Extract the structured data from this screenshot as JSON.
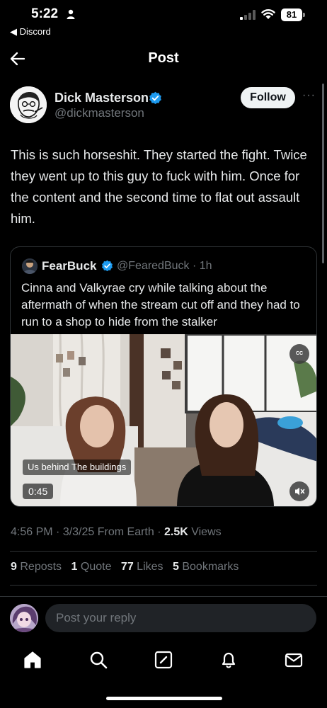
{
  "status_bar": {
    "time": "5:22",
    "back_app": "◀ Discord",
    "battery": "81"
  },
  "header": {
    "title": "Post"
  },
  "post": {
    "author_name": "Dick Masterson",
    "handle": "@dickmasterson",
    "follow_label": "Follow",
    "more_label": "···",
    "text": "This is such horseshit. They started the fight. Twice they went up to this guy to fuck with him. Once for the content and the second time to flat out assault him."
  },
  "quote": {
    "author_name": "FearBuck",
    "meta": "@FearedBuck · 1h",
    "text": "Cinna and Valkyrae cry while talking about the aftermath of when the stream cut off and they had to run to a shop to hide from the stalker",
    "video": {
      "cc_label": "CC",
      "subtitle": "Us behind The buildings",
      "duration": "0:45"
    }
  },
  "meta": {
    "time": "4:56 PM",
    "date": "3/3/25",
    "source": "From Earth",
    "views_count": "2.5K",
    "views_label": "Views"
  },
  "stats": {
    "reposts_count": "9",
    "reposts_label": "Reposts",
    "quotes_count": "1",
    "quotes_label": "Quote",
    "likes_count": "77",
    "likes_label": "Likes",
    "bookmarks_count": "5",
    "bookmarks_label": "Bookmarks"
  },
  "reply": {
    "placeholder": "Post your reply"
  },
  "tabs": [
    "home-icon",
    "search-icon",
    "compose-icon",
    "notifications-icon",
    "messages-icon"
  ],
  "colors": {
    "accent": "#1d9bf0",
    "background": "#000000",
    "muted": "#71767b",
    "text": "#e7e9ea"
  }
}
